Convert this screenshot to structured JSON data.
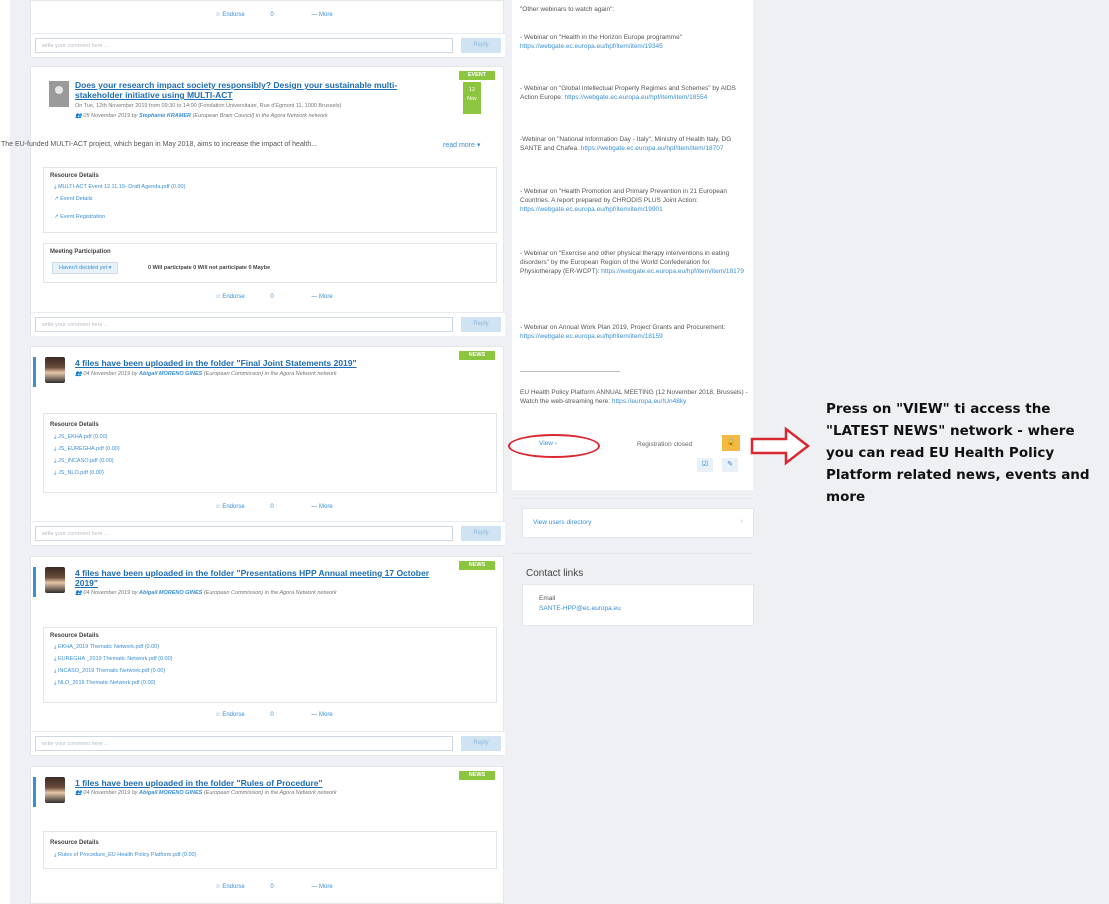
{
  "colors": {
    "accent": "#3b8fd6",
    "badge_green": "#8cc63f",
    "annotation_red": "#d9282f",
    "lock_orange": "#f4b942"
  },
  "common": {
    "endorse": "☆ Endorse",
    "endorse_count": "0",
    "more": "— More",
    "comment_placeholder": "write your comment here ...",
    "reply": "Reply",
    "resource_details": "Resource Details"
  },
  "posts": [
    {
      "badge": "EVENT",
      "date_day": "12",
      "date_month": "Nov",
      "title_line1": "Does your research impact society responsibly? Design your sustainable multi-",
      "title_line2": "stakeholder initiative using MULTI-ACT",
      "when": "On Tue, 12th November 2019 from 09:30 to 14:00 (Fondation Universitaire, Rue d'Egmont 11, 1000 Brussels)",
      "meta_prefix": "05 November 2019 by",
      "author": "Stephanie KRAMER",
      "meta_suffix": "(European Brain Council) in the Agora Network network",
      "description": "The EU-funded MULTI-ACT project, which began in May 2018, aims to increase the impact of health...",
      "read_more": "read more ▾",
      "files": [
        "MULTI-ACT Event 12.11.19- Draft Agenda.pdf (0.00)",
        "Event Details",
        "Event Registration"
      ],
      "meeting_title": "Meeting Participation",
      "meeting_dropdown": "Haven't decided yet ▾",
      "meeting_stats": "0 Will participate   0 Will not participate   0 Maybe"
    },
    {
      "badge": "NEWS",
      "title_line1": "4 files have been uploaded in the folder \"Final Joint Statements 2019\"",
      "meta_prefix": "04 November 2019 by",
      "author": "Abigail MORENO GINES",
      "meta_suffix": "(European Commission) in the Agora Network network",
      "files": [
        "JS_EKHA.pdf (0.00)",
        "JS_EUREGHA.pdf (0.00)",
        "JS_INCASO.pdf (0.00)",
        "JS_NLO.pdf (0.00)"
      ]
    },
    {
      "badge": "NEWS",
      "title_line1": "4 files have been uploaded in the folder \"Presentations HPP Annual meeting 17 October",
      "title_line2": "2019\"",
      "meta_prefix": "04 November 2019 by",
      "author": "Abigail MORENO GINES",
      "meta_suffix": "(European Commission) in the Agora Network network",
      "files": [
        "EKHA_2019 Thematic Network.pdf (0.00)",
        "EUREGHA _2019 Thematic Network.pdf (0.00)",
        "INCASO_2019 Thematic Network.pdf (0.00)",
        "NLO_2019 Thematic Network.pdf (0.00)"
      ]
    },
    {
      "badge": "NEWS",
      "title_line1": "1 files have been uploaded in the folder \"Rules of Procedure\"",
      "meta_prefix": "04 November 2019 by",
      "author": "Abigail MORENO GINES",
      "meta_suffix": "(European Commission) in the Agora Network network",
      "files": [
        "Rules of Procedure_EU Health Policy Platform.pdf (0.00)"
      ]
    }
  ],
  "sidebar": {
    "intro": "\"Other webinars to watch again\":",
    "items": [
      {
        "text": "- Webinar on \"Health in the Horizon Europe programme\"",
        "link": "https://webgate.ec.europa.eu/hpf/item/item/19345"
      },
      {
        "text": "- Webinar on \"Global Intellectual Property Regimes and Schemes\" by AIDS Action Europe:",
        "link": "https://webgate.ec.europa.eu/hpf/item/item/18554"
      },
      {
        "text": "-Webinar on \"National Information Day - Italy\", Ministry of Health Italy, DG SANTE and Chafea.",
        "link": "https://webgate.ec.europa.eu/hpf/item/item/18707"
      },
      {
        "text": "- Webinar on \"Health Promotion and Primary Prevention in 21 European Countries. A report prepared by CHRODIS PLUS Joint Action:",
        "link": "https://webgate.ec.europa.eu/hpf/item/item/19901"
      },
      {
        "text": "- Webinar on \"Exercise and other physical therapy interventions in eating disorders\" by the European Region of the World Confederation for Physiotherapy (ER-WCPT):",
        "link": "https://webgate.ec.europa.eu/hpf/item/item/18179"
      },
      {
        "text": "- Webinar on Annual Work Plan 2019, Project Grants and Procurement:",
        "link": "https://webgate.ec.europa.eu/hpf/item/item/18159"
      }
    ],
    "annual_meeting": "EU Health Policy Platform ANNUAL MEETING (12 November 2018, Brussels) - Watch the web-streaming here:",
    "annual_link": "https://europa.eu/!Un48ky",
    "view": "View ›",
    "registration": "Registration closed",
    "users_directory": "View users directory",
    "chevron": "›",
    "contact_title": "Contact links",
    "email_label": "Email",
    "email": "SANTE-HPP@ec.europa.eu"
  },
  "annotation": "Press on \"VIEW\" ti access the \"LATEST NEWS\" network - where you can read EU Health Policy Platform related news, events and more"
}
